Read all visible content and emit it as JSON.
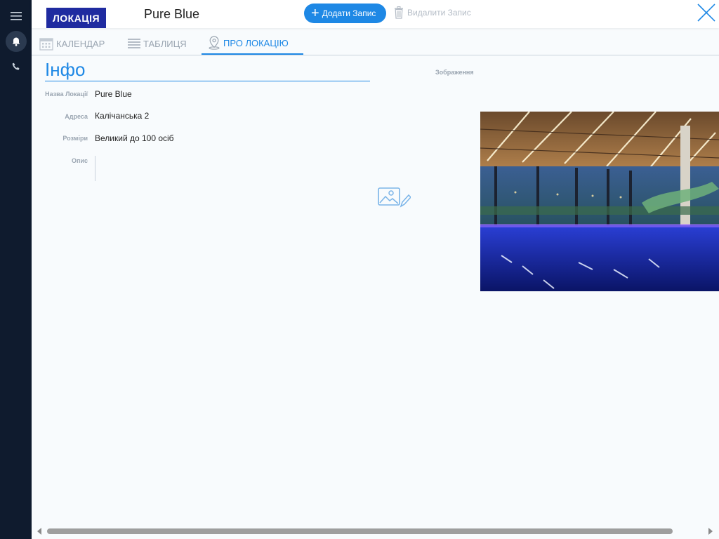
{
  "header": {
    "badge": "ЛОКАЦІЯ",
    "title": "Pure Blue",
    "add_label": "Додати Запис",
    "delete_label": "Видалити Запис"
  },
  "tabs": [
    {
      "label": "КАЛЕНДАР",
      "icon": "calendar-icon"
    },
    {
      "label": "ТАБЛИЦЯ",
      "icon": "table-icon"
    },
    {
      "label": "ПРО ЛОКАЦІЮ",
      "icon": "location-pin-icon",
      "active": true
    }
  ],
  "info": {
    "title": "Інфо",
    "fields": [
      {
        "label": "Назва Локації",
        "value": "Pure Blue"
      },
      {
        "label": "Адреса",
        "value": "Калічанська 2"
      },
      {
        "label": "Розміри",
        "value": "Великий до 100 осіб"
      },
      {
        "label": "Опис",
        "value": ""
      }
    ],
    "image_label": "Зображення"
  },
  "sidebar": {
    "icons": [
      "menu-icon",
      "bell-icon",
      "phone-icon"
    ]
  },
  "colors": {
    "accent": "#1e88e5",
    "badge": "#1f2ba0",
    "sidebar": "#0f1b2e"
  }
}
